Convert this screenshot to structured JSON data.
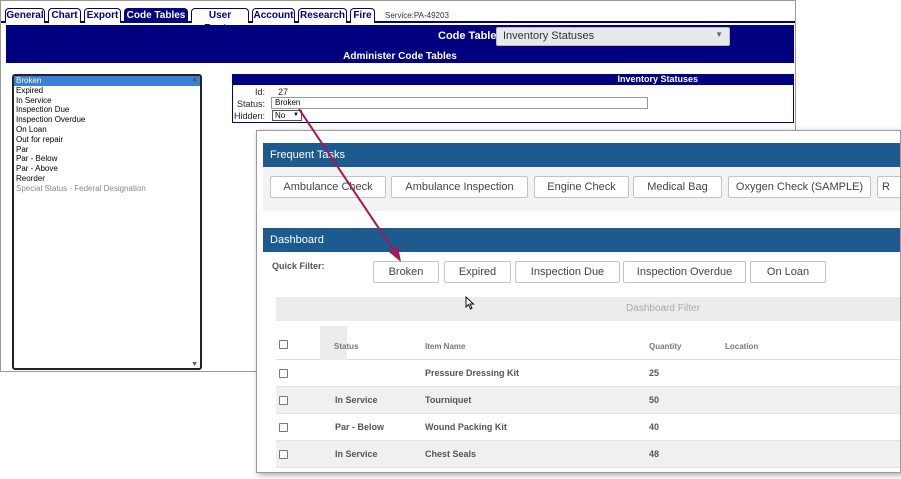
{
  "legacy": {
    "tabs": [
      "General",
      "Chart",
      "Export",
      "Code Tables",
      "User Roster",
      "Account",
      "Research",
      "Fire"
    ],
    "active_tab": "Code Tables",
    "service_label": "Service:PA-49203",
    "code_table_label": "Code Table:",
    "code_table_value": "Inventory Statuses",
    "admin_title": "Administer Code Tables",
    "list_items": [
      "Broken",
      "Expired",
      "In Service",
      "Inspection Due",
      "Inspection Overdue",
      "On Loan",
      "Out for repair",
      "Par",
      "Par - Below",
      "Par - Above",
      "Reorder",
      "Special Status - Federal Designation"
    ],
    "selected_item": "Broken",
    "detail": {
      "title": "Inventory Statuses",
      "id_label": "Id:",
      "id_value": "27",
      "status_label": "Status:",
      "status_value": "Broken",
      "hidden_label": "Hidden:",
      "hidden_value": "No"
    }
  },
  "modern": {
    "frequent_tasks_title": "Frequent Tasks",
    "tasks": [
      "Ambulance Check",
      "Ambulance Inspection",
      "Engine Check",
      "Medical Bag",
      "Oxygen Check (SAMPLE)",
      "R"
    ],
    "dashboard_title": "Dashboard",
    "quick_filter_label": "Quick Filter:",
    "quick_filters": [
      "Broken",
      "Expired",
      "Inspection Due",
      "Inspection Overdue",
      "On Loan"
    ],
    "dashboard_filter_label": "Dashboard Filter",
    "columns": {
      "status": "Status",
      "item_name": "Item Name",
      "quantity": "Quantity",
      "location": "Location"
    },
    "rows": [
      {
        "status": "",
        "item": "Pressure Dressing Kit",
        "quantity": "25",
        "location": ""
      },
      {
        "status": "In Service",
        "item": "Tourniquet",
        "quantity": "50",
        "location": ""
      },
      {
        "status": "Par - Below",
        "item": "Wound Packing Kit",
        "quantity": "40",
        "location": ""
      },
      {
        "status": "In Service",
        "item": "Chest Seals",
        "quantity": "48",
        "location": ""
      }
    ]
  },
  "colors": {
    "legacy_navy": "#000080",
    "dashboard_blue": "#1d5a8e",
    "arrow": "#a0195a",
    "list_selection": "#3b7fd6"
  }
}
